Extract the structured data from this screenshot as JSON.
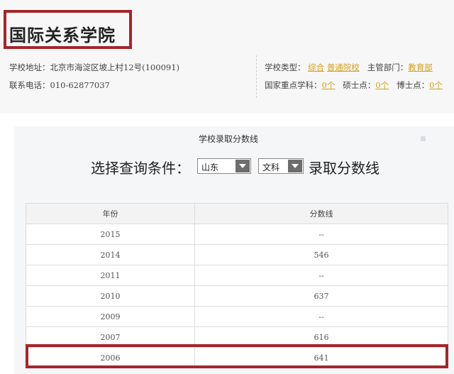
{
  "school": {
    "name": "国际关系学院",
    "address_label": "学校地址：",
    "address": "北京市海淀区坡上村12号(100091)",
    "phone_label": "联系电话：",
    "phone": "010-62877037",
    "type_label": "学校类型：",
    "type_values": [
      "综合",
      "普通院校"
    ],
    "dept_label": "主管部门：",
    "dept_value": "教育部",
    "key_label": "国家重点学科：",
    "key_value": "0个",
    "master_label": "硕士点：",
    "master_value": "0个",
    "doctor_label": "博士点：",
    "doctor_value": "0个"
  },
  "panel": {
    "title": "学校录取分数线",
    "query_label": "选择查询条件：",
    "province": "山东",
    "category": "文科",
    "query_tail": "录取分数线"
  },
  "table": {
    "headers": [
      "年份",
      "分数线"
    ],
    "rows": [
      [
        "2015",
        "--"
      ],
      [
        "2014",
        "546"
      ],
      [
        "2011",
        "--"
      ],
      [
        "2010",
        "637"
      ],
      [
        "2009",
        "--"
      ],
      [
        "2007",
        "616"
      ],
      [
        "2006",
        "641"
      ]
    ]
  },
  "colors": {
    "highlight_border": "#a3262a",
    "link": "#d4a019"
  }
}
